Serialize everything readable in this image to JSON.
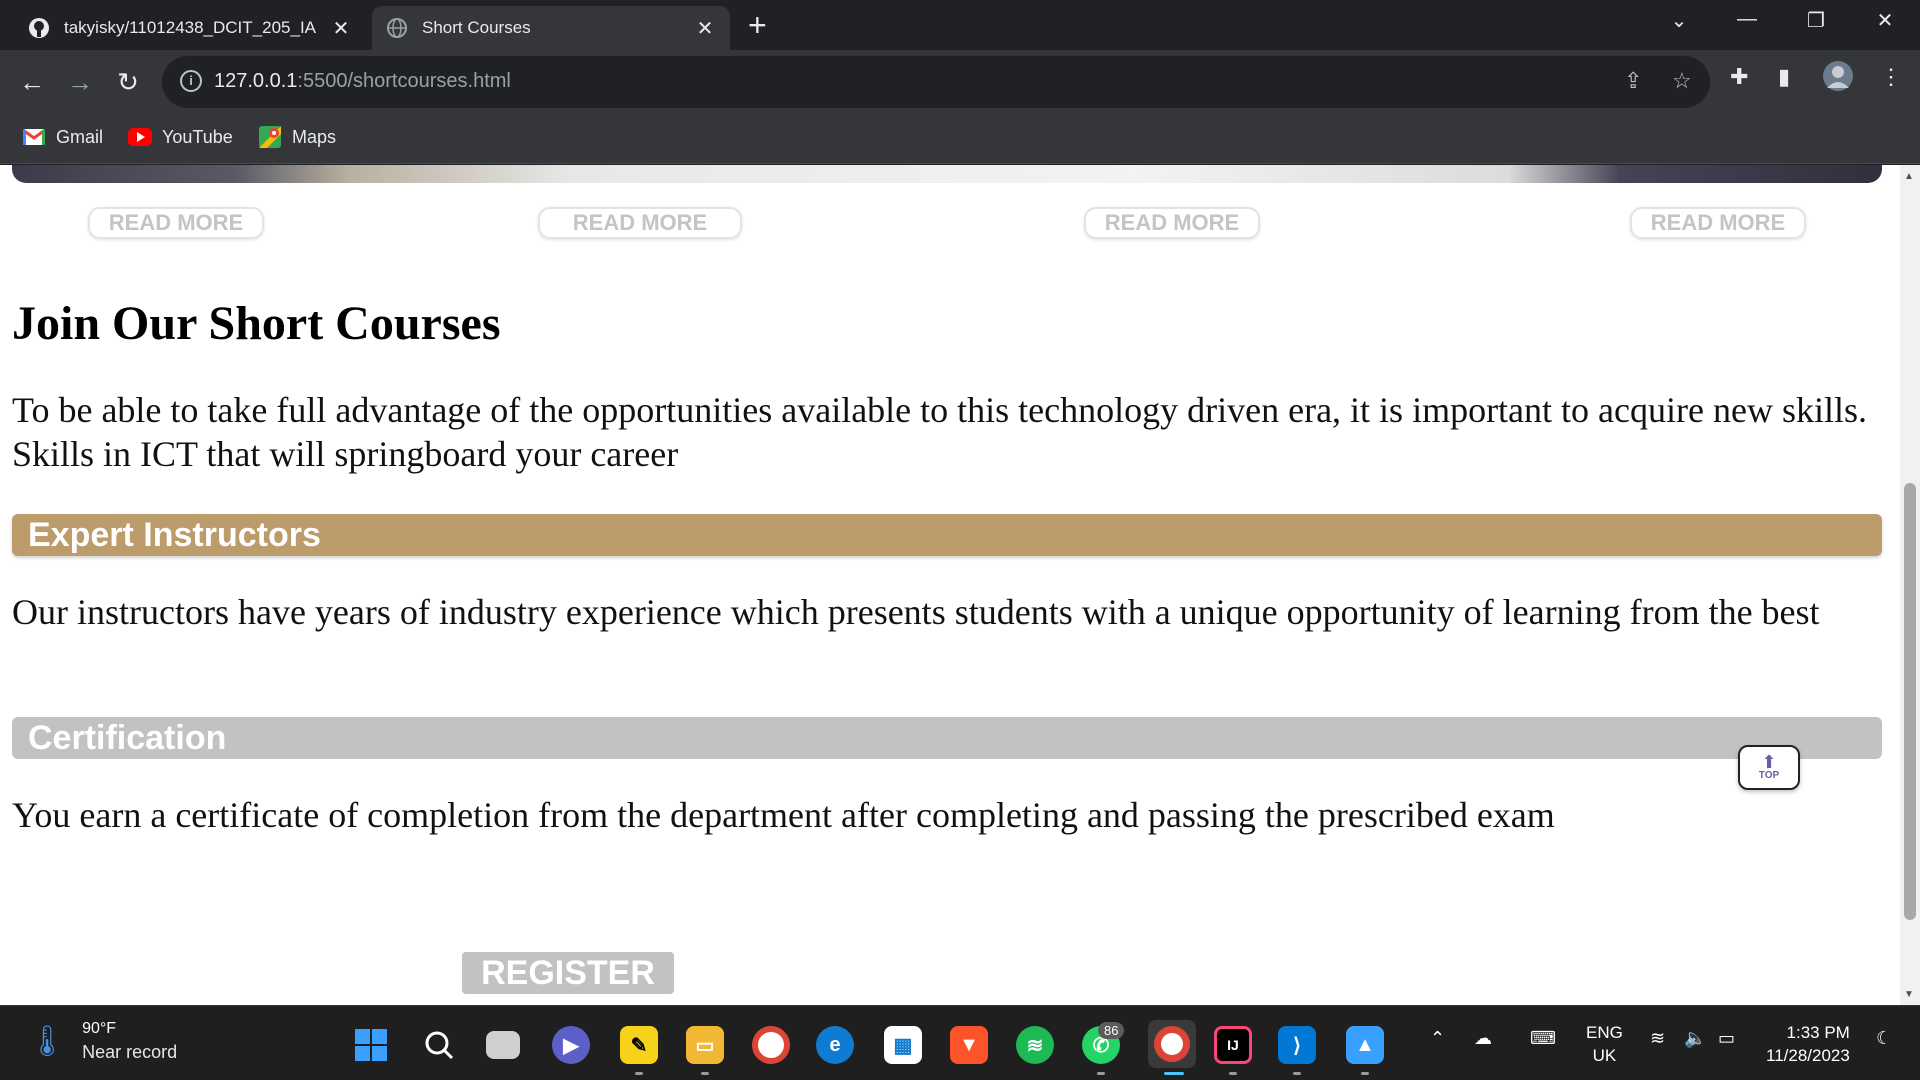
{
  "browser": {
    "tabs": [
      {
        "title": "takyisky/11012438_DCIT_205_IA",
        "favicon": "github-icon",
        "active": false
      },
      {
        "title": "Short Courses",
        "favicon": "globe-icon",
        "active": true
      }
    ],
    "address": {
      "host": "127.0.0.1",
      "rest": ":5500/shortcourses.html"
    },
    "bookmarks": [
      {
        "label": "Gmail",
        "icon": "gmail-icon"
      },
      {
        "label": "YouTube",
        "icon": "youtube-icon"
      },
      {
        "label": "Maps",
        "icon": "maps-icon"
      }
    ]
  },
  "page": {
    "read_more": [
      "READ MORE",
      "READ MORE",
      "READ MORE",
      "READ MORE"
    ],
    "title": "Join Our Short Courses",
    "intro": "To be able to take full advantage of the opportunities available to this technology driven era, it is important to acquire new skills. Skills in ICT that will springboard your career",
    "sections": [
      {
        "heading": "Expert Instructors",
        "text": "Our instructors have years of industry experience which presents students with a unique opportunity of learning from the best",
        "color": "#bd9c6c"
      },
      {
        "heading": "Certification",
        "text": "You earn a certificate of completion from the department after completing and passing the prescribed exam",
        "color": "#c2c2c2"
      }
    ],
    "register_label": "REGISTER",
    "top_button_label": "TOP"
  },
  "taskbar": {
    "weather": {
      "temp": "90°F",
      "desc": "Near record"
    },
    "whatsapp_badge": "86",
    "language": {
      "line1": "ENG",
      "line2": "UK"
    },
    "clock": {
      "time": "1:33 PM",
      "date": "11/28/2023"
    }
  }
}
